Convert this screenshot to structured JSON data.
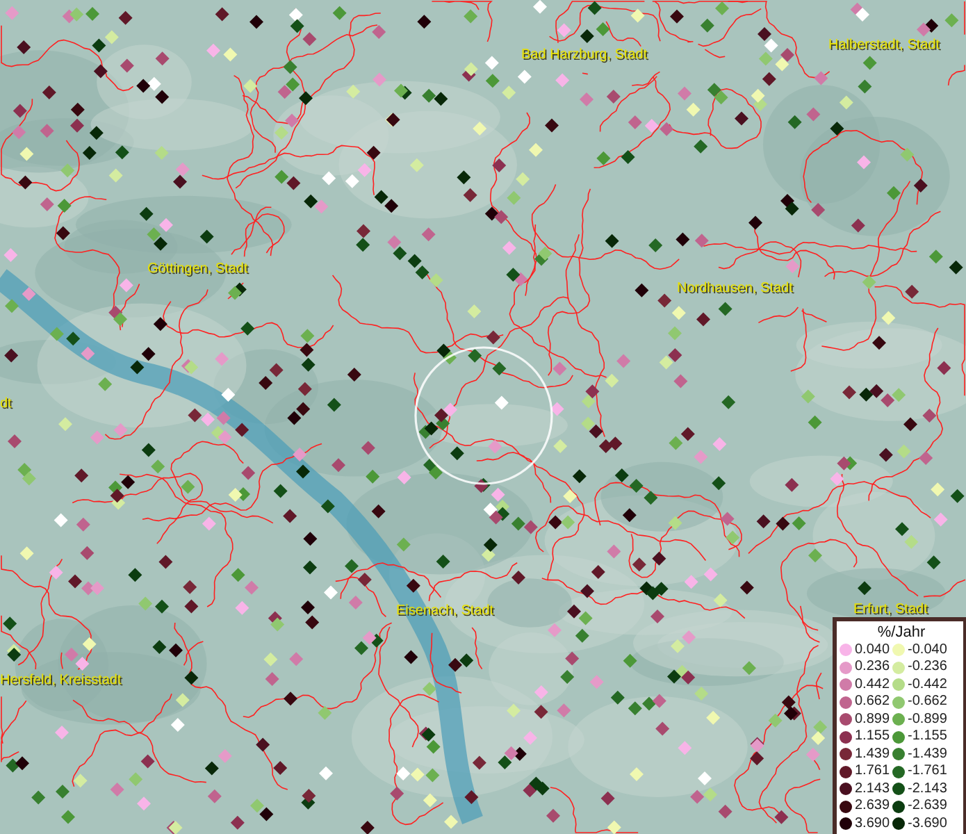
{
  "map": {
    "place_labels": [
      {
        "text": "Bad Harzburg, Stadt"
      },
      {
        "text": "Halberstadt, Stadt"
      },
      {
        "text": "Göttingen, Stadt"
      },
      {
        "text": "Nordhausen, Stadt"
      },
      {
        "text": "dt"
      },
      {
        "text": "Eisenach, Stadt"
      },
      {
        "text": "Erfurt, Stadt"
      },
      {
        "text": "Hersfeld, Kreisstadt"
      }
    ]
  },
  "legend": {
    "title": "%/Jahr",
    "positive": [
      {
        "value": "0.040",
        "color": "#f8b4e8"
      },
      {
        "value": "0.236",
        "color": "#e59ac8"
      },
      {
        "value": "0.442",
        "color": "#d07ba8"
      },
      {
        "value": "0.662",
        "color": "#c0648e"
      },
      {
        "value": "0.899",
        "color": "#a84a6e"
      },
      {
        "value": "1.155",
        "color": "#8c3050"
      },
      {
        "value": "1.439",
        "color": "#782838"
      },
      {
        "value": "1.761",
        "color": "#601828"
      },
      {
        "value": "2.143",
        "color": "#4a1020"
      },
      {
        "value": "2.639",
        "color": "#380810"
      },
      {
        "value": "3.690",
        "color": "#200008"
      }
    ],
    "negative": [
      {
        "value": "-0.040",
        "color": "#f0f8b0"
      },
      {
        "value": "-0.236",
        "color": "#d4eca0"
      },
      {
        "value": "-0.442",
        "color": "#b4dc88"
      },
      {
        "value": "-0.662",
        "color": "#90c870"
      },
      {
        "value": "-0.899",
        "color": "#6cb050"
      },
      {
        "value": "-1.155",
        "color": "#4c9838"
      },
      {
        "value": "-1.439",
        "color": "#388030"
      },
      {
        "value": "-1.761",
        "color": "#246824"
      },
      {
        "value": "-2.143",
        "color": "#145018"
      },
      {
        "value": "-2.639",
        "color": "#0c3c10"
      },
      {
        "value": "-3.690",
        "color": "#082808"
      }
    ]
  }
}
